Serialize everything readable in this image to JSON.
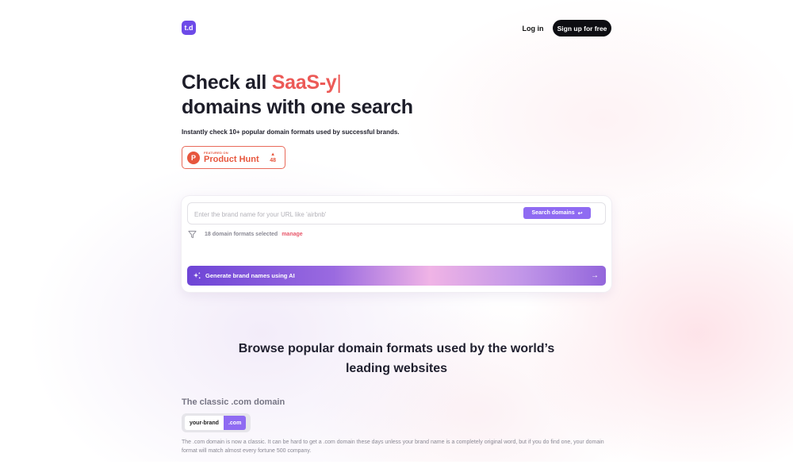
{
  "header": {
    "logo_text": "t.d",
    "login_label": "Log in",
    "signup_label": "Sign up for free"
  },
  "hero": {
    "title_prefix": "Check all ",
    "title_accent": "SaaS-y",
    "title_cursor": "|",
    "title_line2": "domains with one search",
    "subtitle": "Instantly check 10+ popular domain formats used by successful brands."
  },
  "product_hunt": {
    "featured_label": "FEATURED ON",
    "name": "Product Hunt",
    "logo_letter": "P",
    "vote_arrow": "▲",
    "votes": "48"
  },
  "search": {
    "placeholder": "Enter the brand name for your URL like 'airbnb'",
    "value": "",
    "button_label": "Search domains",
    "button_icon": "↩",
    "formats_selected": "18 domain formats selected",
    "manage_label": "manage"
  },
  "ai": {
    "label": "Generate brand names using AI",
    "arrow": "→"
  },
  "browse": {
    "title": "Browse popular domain formats used by the world’s leading websites"
  },
  "classic": {
    "title": "The classic .com domain",
    "brand_part": "your-brand",
    "tld_part": ".com",
    "description": "The .com domain is now a classic. It can be hard to get a .com domain these days unless your brand name is a completely original word, but if you do find one, your domain format will match almost every fortune 500 company."
  },
  "colors": {
    "accent_purple": "#8f6bf2",
    "accent_red": "#ec5a57",
    "product_hunt": "#e7563d",
    "dark": "#0d0d12"
  },
  "icons": {
    "filter": "funnel-icon",
    "ai": "sparkle-icon",
    "enter": "enter-icon",
    "arrow": "arrow-right-icon"
  }
}
